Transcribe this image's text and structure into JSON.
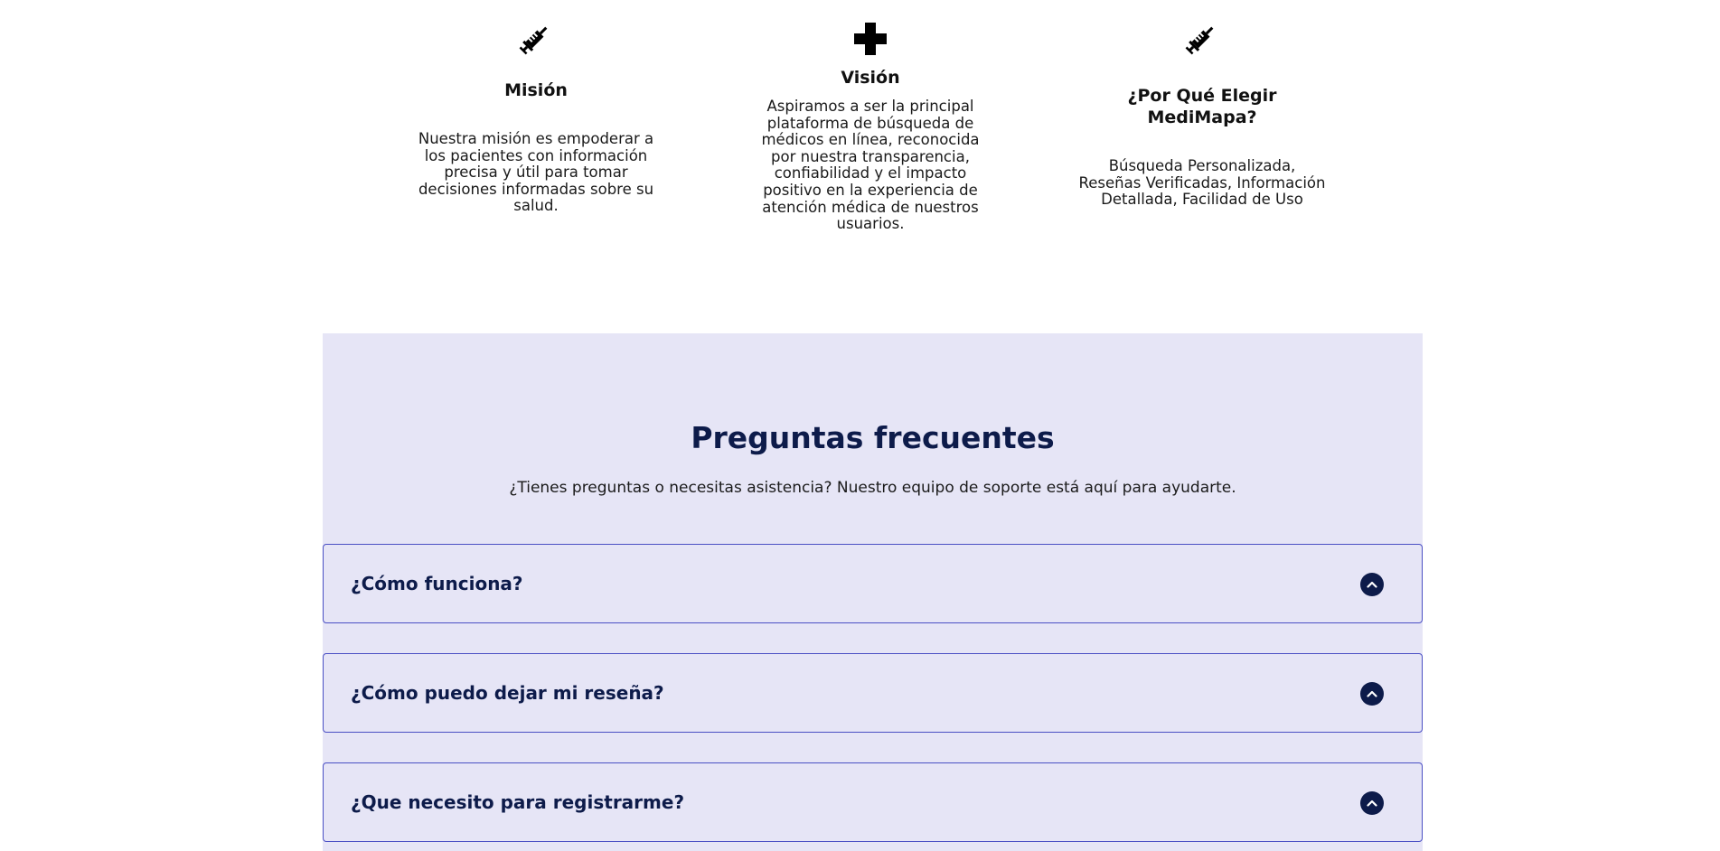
{
  "info": {
    "mision": {
      "icon": "syringe-icon",
      "title": "Misión",
      "text": "Nuestra misión es empoderar a los pacientes con información precisa y útil para tomar decisiones informadas sobre su salud."
    },
    "vision": {
      "icon": "plus-icon",
      "title": "Visión",
      "text": "Aspiramos a ser la principal plataforma de búsqueda de médicos en línea, reconocida por nuestra transparencia, confiabilidad y el impacto positivo en la experiencia de atención médica de nuestros usuarios."
    },
    "why": {
      "icon": "syringe-icon",
      "title": "¿Por Qué Elegir MediMapa?",
      "text": "Búsqueda Personalizada, Reseñas Verificadas, Información Detallada, Facilidad de Uso"
    }
  },
  "faq": {
    "title": "Preguntas frecuentes",
    "subtitle": "¿Tienes preguntas o necesitas asistencia? Nuestro equipo de soporte está aquí para ayudarte.",
    "items": [
      {
        "question": "¿Cómo funciona?",
        "icon": "chevron-up-icon"
      },
      {
        "question": "¿Cómo puedo dejar mi reseña?",
        "icon": "chevron-up-icon"
      },
      {
        "question": "¿Que necesito para registrarme?",
        "icon": "chevron-up-icon"
      }
    ]
  },
  "colors": {
    "faq_background": "#e6e5f6",
    "faq_border": "#4a4fc4",
    "heading_navy": "#0d1b4a"
  }
}
